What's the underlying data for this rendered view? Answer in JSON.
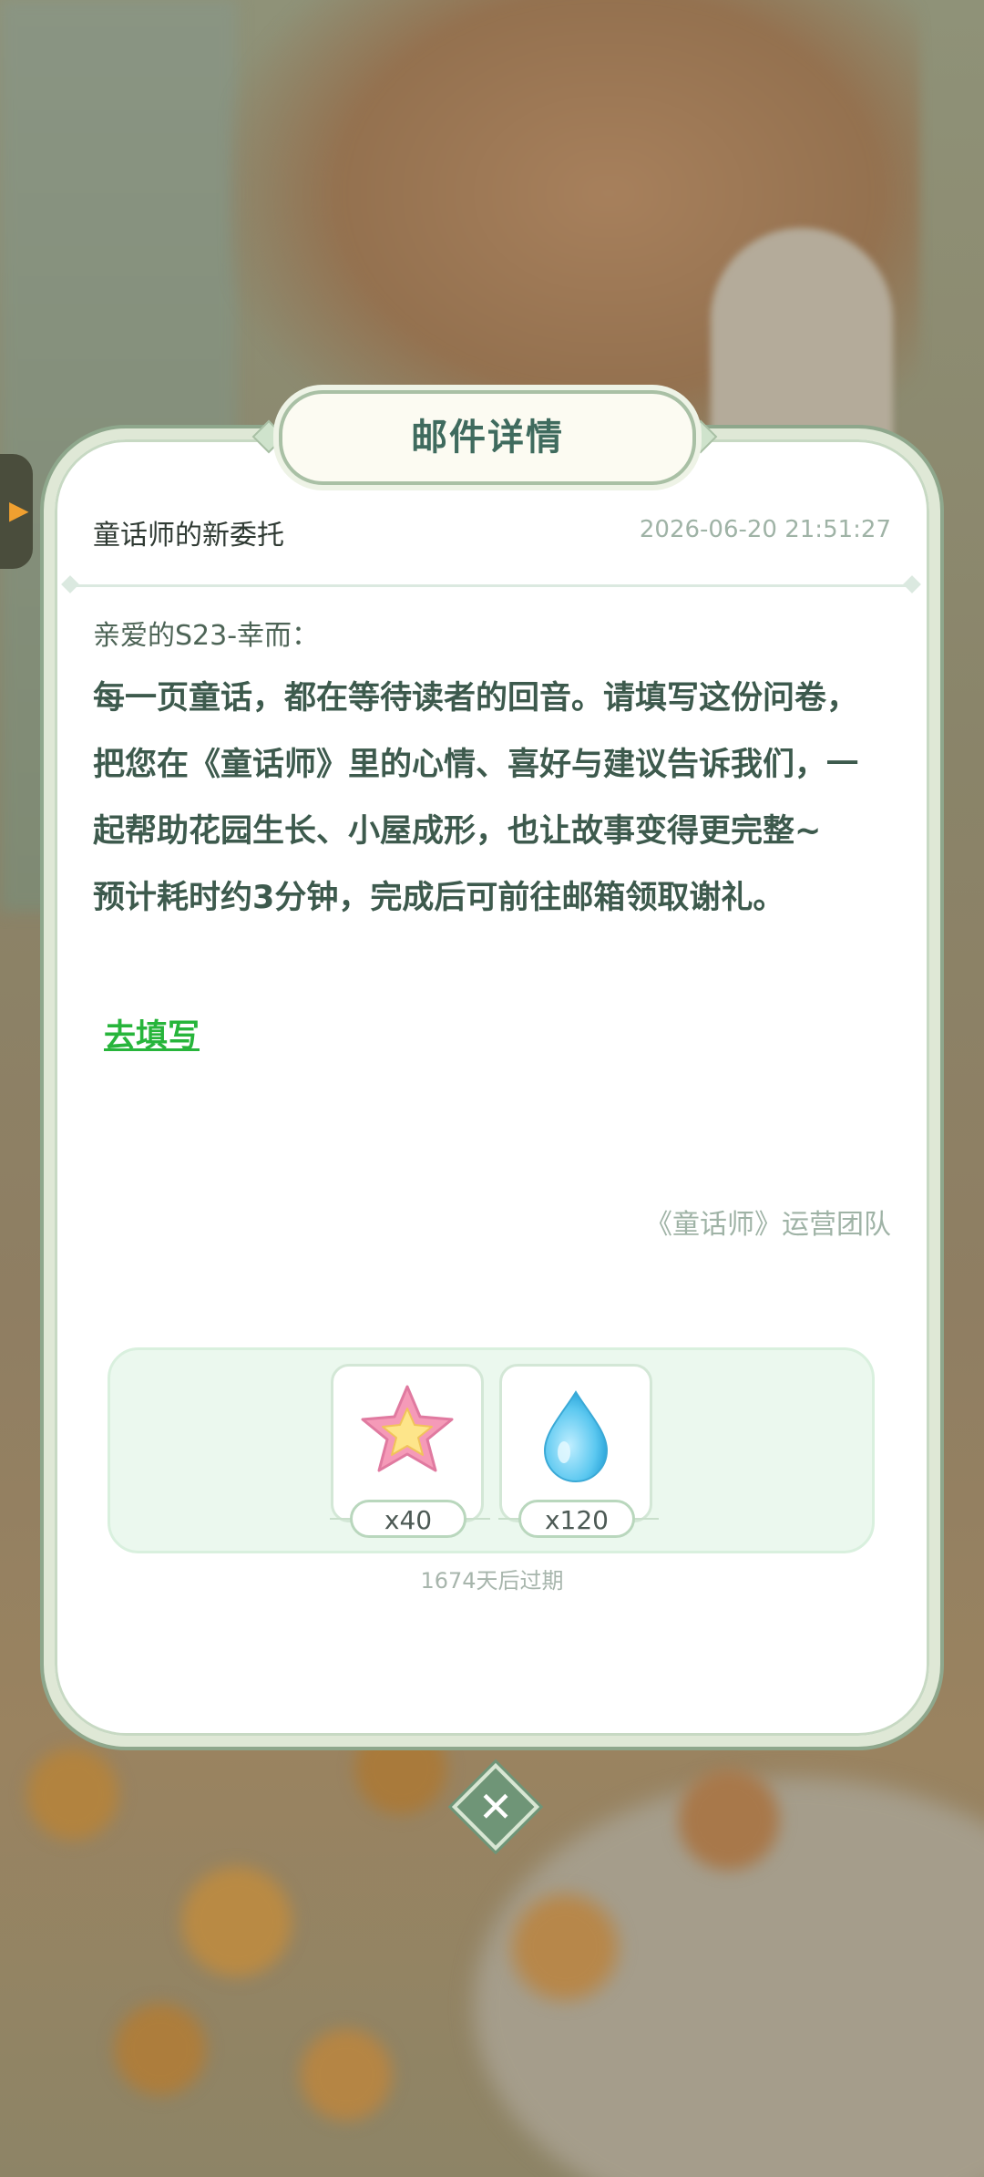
{
  "dialog": {
    "title": "邮件详情",
    "subject": "童话师的新委托",
    "date": "2026-06-20 21:51:27",
    "greeting": "亲爱的S23-幸而：",
    "paragraphs": [
      "每一页童话，都在等待读者的回音。请填写这份问卷，把您在《童话师》里的心情、喜好与建议告诉我们，一起帮助花园生长、小屋成形，也让故事变得更完整~",
      "预计耗时约3分钟，完成后可前往邮箱领取谢礼。"
    ],
    "link_label": "去填写",
    "signature": "《童话师》运营团队",
    "rewards": [
      {
        "icon": "pink-star-icon",
        "quantity": "x40"
      },
      {
        "icon": "water-drop-icon",
        "quantity": "x120"
      }
    ],
    "expiry": "1674天后过期"
  },
  "colors": {
    "title_text": "#3f6b5e",
    "body_text": "#3d5a4d",
    "link": "#27b53b",
    "muted": "#9fb3a6",
    "reward_panel": "#ebf8ee",
    "close_button": "#6f9577"
  }
}
